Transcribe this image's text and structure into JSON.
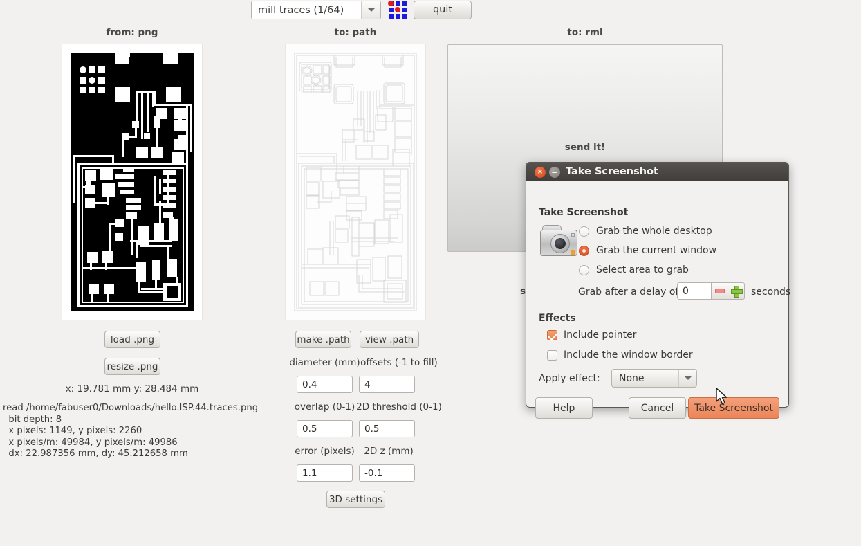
{
  "toolbar": {
    "process_select_value": "mill traces (1/64)",
    "process_options": [
      "mill traces (1/64)"
    ],
    "grid_icon_name": "grid-icon",
    "quit_label": "quit"
  },
  "columns": {
    "png_title": "from: png",
    "path_title": "to: path",
    "rml_title": "to: rml"
  },
  "png_panel": {
    "load_button": "load .png",
    "resize_button": "resize .png",
    "coords": "x: 19.781 mm  y: 28.484 mm",
    "log": "read /home/fabuser0/Downloads/hello.ISP.44.traces.png\n  bit depth: 8\n  x pixels: 1149, y pixels: 2260\n  x pixels/m: 49984, y pixels/m: 49986\n  dx: 22.987356 mm, dy: 45.212658 mm"
  },
  "path_panel": {
    "make_button": "make .path",
    "view_button": "view .path",
    "fields": [
      {
        "label": "diameter (mm)",
        "value": "0.4"
      },
      {
        "label": "offsets (-1 to fill)",
        "value": "4"
      },
      {
        "label": "overlap (0-1)",
        "value": "0.5"
      },
      {
        "label": "2D threshold (0-1)",
        "value": "0.5"
      },
      {
        "label": "error (pixels)",
        "value": "1.1"
      },
      {
        "label": "2D z (mm)",
        "value": "-0.1"
      }
    ],
    "settings_button": "3D settings"
  },
  "rml_panel": {
    "send_label": "send it!",
    "occluded_label": "s"
  },
  "dialog": {
    "window_title": "Take Screenshot",
    "section_title": "Take Screenshot",
    "camera_icon_name": "camera-icon",
    "radio_options": [
      {
        "label": "Grab the whole desktop",
        "selected": false
      },
      {
        "label": "Grab the current window",
        "selected": true
      },
      {
        "label": "Select area to grab",
        "selected": false
      }
    ],
    "delay_prefix": "Grab after a delay of",
    "delay_value": "0",
    "delay_suffix": "seconds",
    "effects_title": "Effects",
    "checkboxes": [
      {
        "label": "Include pointer",
        "checked": true
      },
      {
        "label": "Include the window border",
        "checked": false
      }
    ],
    "apply_effect_label": "Apply effect:",
    "apply_effect_value": "None",
    "apply_effect_options": [
      "None"
    ],
    "help_button": "Help",
    "cancel_button": "Cancel",
    "take_button": "Take Screenshot"
  },
  "colors": {
    "window_bg": "#f2f1f0",
    "accent_orange": "#ec8559",
    "titlebar_dark": "#4a4643",
    "grid_blue": "#1a1ae0",
    "grid_red": "#e01b1b"
  }
}
